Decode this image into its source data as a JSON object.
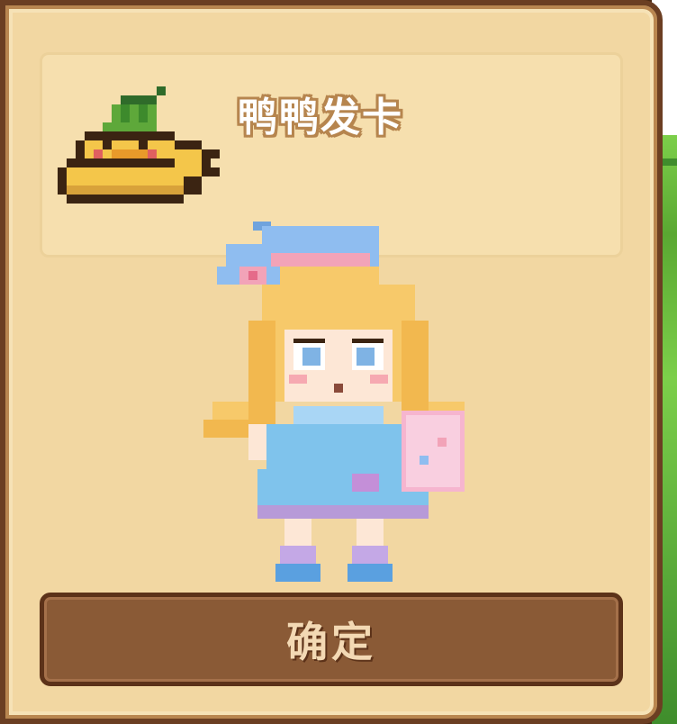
{
  "item": {
    "name": "鸭鸭发卡",
    "icon": "duck-hairclip-icon"
  },
  "character": {
    "icon": "character-avatar"
  },
  "actions": {
    "confirm_label": "确定"
  },
  "colors": {
    "panel": "#f2d7a2",
    "border": "#6b3e22",
    "button": "#8a5a36",
    "button_text": "#f3d9b4"
  }
}
